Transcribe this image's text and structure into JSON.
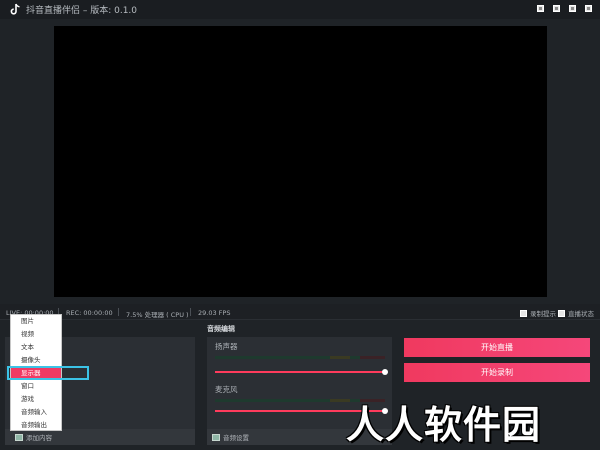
{
  "window": {
    "title": "抖音直播伴侣 – 版本: 0.1.0",
    "logo_icon": "tiktok-logo-icon"
  },
  "statusbar": {
    "live": "LIVE: 00:00:00",
    "rec": "REC: 00:00:00",
    "cpu": "7.5% 处理器 ( CPU )",
    "fps": "29.03 FPS",
    "record_tip_label": "录制提示",
    "live_status_label": "直播状态"
  },
  "sources": {
    "add_label": "添加内容",
    "menu": [
      {
        "label": "图片"
      },
      {
        "label": "视频"
      },
      {
        "label": "文本"
      },
      {
        "label": "摄像头"
      },
      {
        "label": "显示器",
        "active": true
      },
      {
        "label": "窗口"
      },
      {
        "label": "游戏"
      },
      {
        "label": "音频输入"
      },
      {
        "label": "音频输出"
      }
    ]
  },
  "audio": {
    "title": "音频编辑",
    "speaker_label": "扬声器",
    "mic_label": "麦克风",
    "settings_label": "音频设置",
    "speaker_volume": 1.0,
    "mic_volume": 1.0
  },
  "actions": {
    "start_live": "开始直播",
    "start_record": "开始录制"
  },
  "watermark": "人人软件园",
  "colors": {
    "accent": "#f03a63",
    "highlight": "#3bc3e6"
  }
}
